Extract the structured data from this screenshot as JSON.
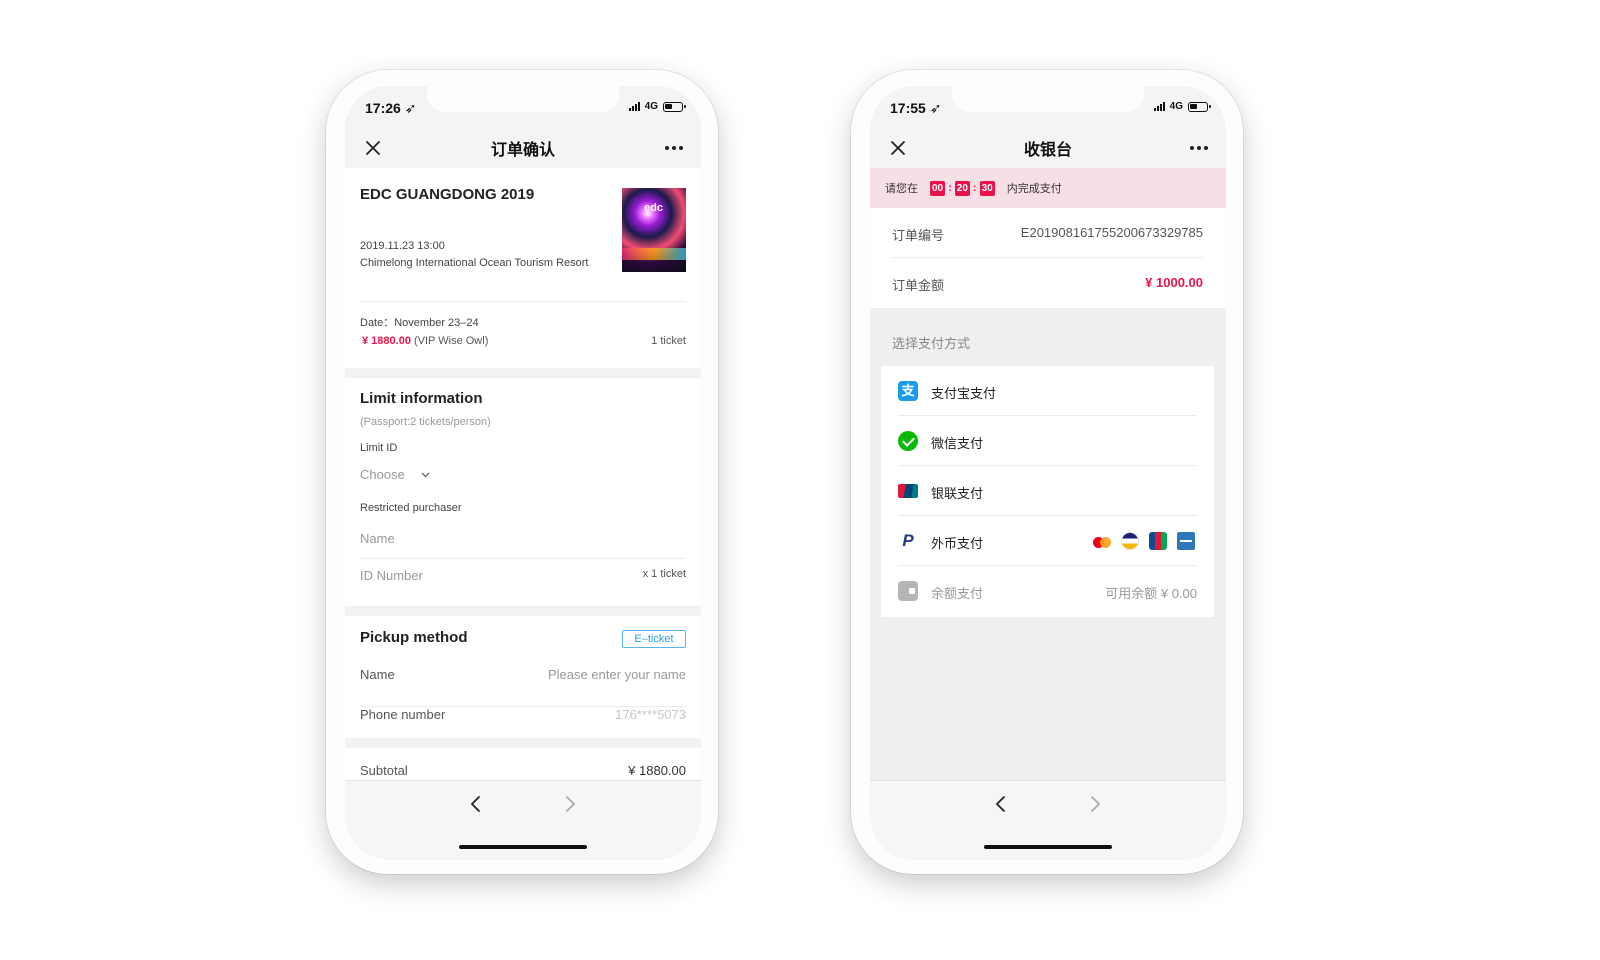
{
  "left_phone": {
    "status": {
      "time": "17:26 ➶",
      "network": "4G"
    },
    "nav": {
      "title": "订单确认"
    },
    "event": {
      "title": "EDC GUANGDONG 2019",
      "datetime": "2019.11.23 13:00",
      "venue": "Chimelong International Ocean Tourism Resort",
      "poster_logo": "edc"
    },
    "ticket": {
      "date": "Date：November 23–24",
      "price": "¥ 1880.00",
      "price_type": "(VIP Wise Owl)",
      "quantity": "1   ticket"
    },
    "limit": {
      "title": "Limit information",
      "note": "(Passport:2 tickets/person)",
      "id_label": "Limit ID",
      "choose": "Choose",
      "purchaser_label": "Restricted purchaser",
      "name_placeholder": "Name",
      "id_number_label": "ID Number",
      "id_number_count": "x 1 ticket"
    },
    "pickup": {
      "title": "Pickup method",
      "badge": "E–ticket",
      "name_label": "Name",
      "name_placeholder": "Please enter your name",
      "phone_label": "Phone number",
      "phone_value": "176****5073"
    },
    "subtotal": {
      "label": "Subtotal",
      "value": "¥  1880.00"
    }
  },
  "right_phone": {
    "status": {
      "time": "17:55 ➶",
      "network": "4G"
    },
    "nav": {
      "title": "收银台"
    },
    "countdown": {
      "prefix": "请您在",
      "hours": "00",
      "minutes": "20",
      "seconds": "30",
      "suffix": "内完成支付"
    },
    "order": {
      "number_label": "订单编号",
      "number_value": "E20190816175520067332978​5",
      "amount_label": "订单金额",
      "amount_value": "¥ 1000.00"
    },
    "payment": {
      "section_title": "选择支付方式",
      "methods": [
        {
          "label": "支付宝支付",
          "icon": "alipay-icon"
        },
        {
          "label": "微信支付",
          "icon": "wechat-pay-icon"
        },
        {
          "label": "银联支付",
          "icon": "unionpay-icon"
        },
        {
          "label": "外币支付",
          "icon": "paypal-icon",
          "cards": [
            "mastercard-icon",
            "visa-icon",
            "jcb-icon",
            "amex-icon"
          ]
        },
        {
          "label": "余额支付",
          "icon": "wallet-icon",
          "extra": "可用余额  ¥ 0.00"
        }
      ]
    }
  },
  "colors": {
    "accent_red": "#e8134b",
    "badge_blue": "#2b9de6",
    "countdown_bg": "#f7dfe6"
  }
}
